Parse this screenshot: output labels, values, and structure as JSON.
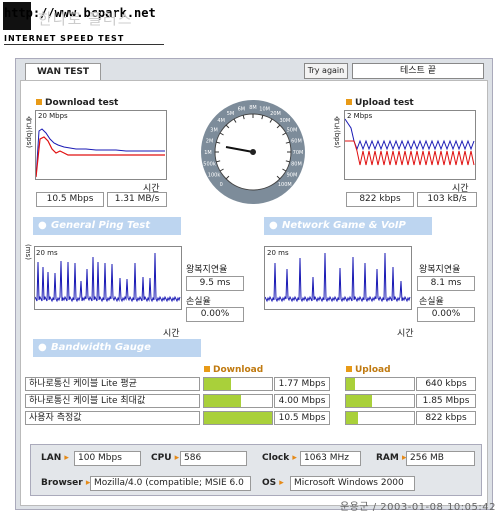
{
  "header": {
    "url_text": "http://www.bcpark.net",
    "logo_text": "한나로 플러스",
    "subtitle": "INTERNET SPEED TEST"
  },
  "toolbar": {
    "tab_label": "WAN TEST",
    "try_again_label": "Try again",
    "status_text": "테스트 끝"
  },
  "download": {
    "title": "Download test",
    "y_axis": "속도(bps)",
    "scale": "20 Mbps",
    "x_label": "시간",
    "mbps": "10.5 Mbps",
    "mbs": "1.31 MB/s"
  },
  "upload": {
    "title": "Upload test",
    "y_axis": "속도(bps)",
    "scale": "2 Mbps",
    "x_label": "시간",
    "kbps": "822 kbps",
    "kbs": "103 kB/s"
  },
  "gauge": {
    "tick_labels": [
      "0",
      "100k",
      "500k",
      "1M",
      "2M",
      "3M",
      "4M",
      "5M",
      "6M",
      "8M",
      "10M",
      "20M",
      "30M",
      "50M",
      "60M",
      "70M",
      "80M",
      "90M",
      "100M"
    ]
  },
  "ping": {
    "band_title": "General Ping Test",
    "y_axis": "(ms)",
    "scale": "20 ms",
    "x_label": "시간",
    "rtt_label": "왕복지연율",
    "rtt_value": "9.5 ms",
    "loss_label": "손실율",
    "loss_value": "0.00%"
  },
  "game": {
    "band_title": "Network Game & VoIP Test",
    "scale": "20 ms",
    "x_label": "시간",
    "rtt_label": "왕복지연율",
    "rtt_value": "8.1 ms",
    "loss_label": "손실율",
    "loss_value": "0.00%"
  },
  "bandwidth": {
    "band_title": "Bandwidth Gauge",
    "download_header": "Download",
    "upload_header": "Upload",
    "rows": [
      {
        "label": "하나로통신 케이블 Lite 평균",
        "down": "1.77 Mbps",
        "down_fill": 0.39,
        "up": "640 kbps",
        "up_fill": 0.13
      },
      {
        "label": "하나로통신 케이블 Lite 최대값",
        "down": "4.00 Mbps",
        "down_fill": 0.55,
        "up": "1.85 Mbps",
        "up_fill": 0.38
      },
      {
        "label": "사용자 측정값",
        "down": "10.5 Mbps",
        "down_fill": 1.0,
        "up": "822 kbps",
        "up_fill": 0.17
      }
    ]
  },
  "system": {
    "lan_key": "LAN",
    "lan_val": "100 Mbps",
    "cpu_key": "CPU",
    "cpu_val": "586",
    "clock_key": "Clock",
    "clock_val": "1063 MHz",
    "ram_key": "RAM",
    "ram_val": "256 MB",
    "browser_key": "Browser",
    "browser_val": "Mozilla/4.0 (compatible; MSIE 6.0",
    "os_key": "OS",
    "os_val": "Microsoft Windows 2000"
  },
  "footer": {
    "text": "운용군 / 2003-01-08 10:05:42"
  },
  "colors": {
    "accent": "#e89a17",
    "band": "#bdd5f0",
    "bar": "#a9d03a",
    "series_blue": "#1a1ab5",
    "series_red": "#e01010"
  }
}
